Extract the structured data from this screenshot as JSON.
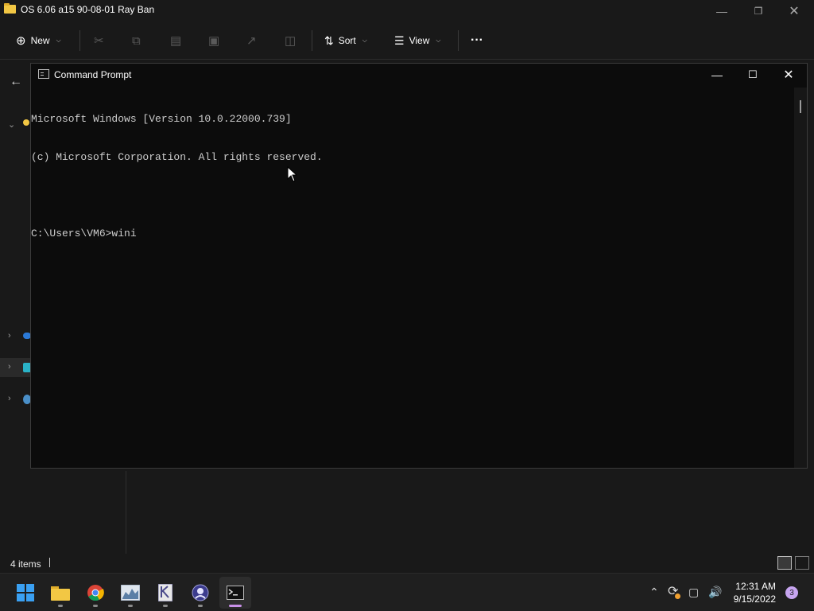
{
  "explorer": {
    "title": "OS 6.06 a15 90-08-01 Ray Ban",
    "toolbar": {
      "new_label": "New",
      "sort_label": "Sort",
      "view_label": "View",
      "more_label": "···"
    },
    "status": {
      "item_count": "4 items"
    }
  },
  "cmd": {
    "title": "Command Prompt",
    "lines": [
      "Microsoft Windows [Version 10.0.22000.739]",
      "(c) Microsoft Corporation. All rights reserved.",
      "",
      "C:\\Users\\VM6>wini"
    ]
  },
  "taskbar": {
    "apps": [
      "start-icon",
      "file-explorer-icon",
      "chrome-icon",
      "app-chart-icon",
      "app-editor-icon",
      "app-badge-icon",
      "terminal-icon"
    ],
    "clock": {
      "time": "12:31 AM",
      "date": "9/15/2022"
    },
    "notification_count": "3"
  },
  "colors": {
    "accent": "#c891e8",
    "console_bg": "#0c0c0c",
    "console_text": "#cccccc"
  }
}
